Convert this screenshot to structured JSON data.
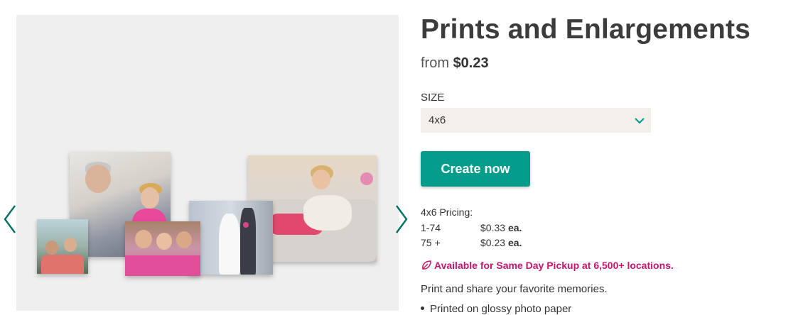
{
  "gallery": {
    "prev_icon": "chevron-left-icon",
    "next_icon": "chevron-right-icon",
    "arrow_color": "#036f63"
  },
  "product": {
    "title": "Prints and Enlargements",
    "price_prefix": "from",
    "price_value": "$0.23"
  },
  "size": {
    "label": "SIZE",
    "selected": "4x6",
    "icon": "chevron-down-icon"
  },
  "cta": {
    "label": "Create now",
    "color": "#049d8c"
  },
  "pricing": {
    "title": "4x6 Pricing:",
    "rows": [
      {
        "qty": "1-74",
        "price": "$0.33",
        "unit": "ea."
      },
      {
        "qty": "75 +",
        "price": "$0.23",
        "unit": "ea."
      }
    ]
  },
  "pickup": {
    "text": "Available for Same Day Pickup at 6,500+ locations.",
    "icon": "leaf-icon",
    "color": "#c5166e"
  },
  "description": {
    "text": "Print and share your favorite memories.",
    "bullets": [
      "Printed on glossy photo paper"
    ]
  }
}
